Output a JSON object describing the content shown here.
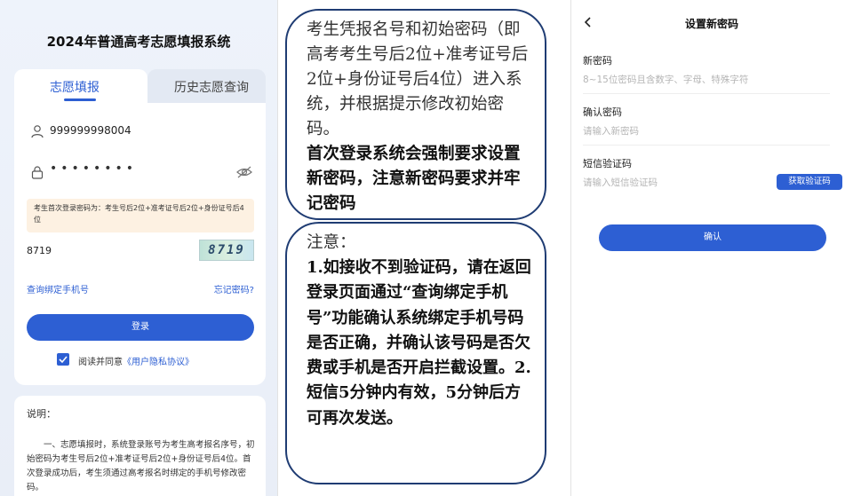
{
  "login": {
    "title": "2024年普通高考志愿填报系统",
    "tabs": [
      {
        "label": "志愿填报",
        "active": true
      },
      {
        "label": "历史志愿查询",
        "active": false
      }
    ],
    "username": "999999998004",
    "password_mask": "••••••••",
    "hint": "考生首次登录密码为：考生号后2位+准考证号后2位+身份证号后4位",
    "captcha_value": "8719",
    "captcha_image_text": "8719",
    "link_phone": "查询绑定手机号",
    "link_forgot": "忘记密码?",
    "login_button": "登录",
    "agree_text": "阅读并同意",
    "agree_link": "《用户隐私协议》",
    "note_title": "说明：",
    "note_body": "一、志愿填报时，系统登录账号为考生高考报名序号，初始密码为考生号后2位+准考证号后2位+身份证号后4位。首次登录成功后，考生须通过高考报名时绑定的手机号修改密码。"
  },
  "instructions": {
    "bubble1_plain": "考生凭报名号和初始密码（即高考考生号后2位+准考证号后2位+身份证号后4位）进入系统，并根据提示修改初始密码。",
    "bubble1_bold": "首次登录系统会强制要求设置新密码，注意新密码要求并牢记密码",
    "bubble2_head": "注意：",
    "bubble2_text": "1.如接收不到验证码，请在返回登录页面通过“查询绑定手机号”功能确认系统绑定手机号码是否正确，并确认该号码是否欠费或手机是否开启拦截设置。2.短信5分钟内有效，5分钟后方可再次发送。"
  },
  "reset": {
    "title": "设置新密码",
    "new_pwd_label": "新密码",
    "new_pwd_placeholder": "8~15位密码且含数字、字母、特殊字符",
    "confirm_label": "确认密码",
    "confirm_placeholder": "请输入新密码",
    "sms_label": "短信验证码",
    "sms_placeholder": "请输入短信验证码",
    "sms_button": "获取验证码",
    "confirm_button": "确认"
  },
  "colors": {
    "accent": "#2d5fd3",
    "bubble_border": "#1f3c73",
    "hint_bg": "#fdf1e2"
  },
  "icons": [
    "user-icon",
    "lock-icon",
    "eye-off-icon",
    "checkbox-check-icon",
    "back-arrow-icon"
  ]
}
